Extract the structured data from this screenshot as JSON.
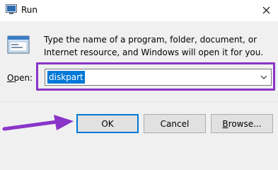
{
  "window": {
    "title": "Run",
    "close_glyph": "✕"
  },
  "dialog": {
    "description": "Type the name of a program, folder, document, or Internet resource, and Windows will open it for you.",
    "open_label_underlined": "O",
    "open_label_rest": "pen:",
    "open_value": "diskpart"
  },
  "buttons": {
    "ok": "OK",
    "cancel": "Cancel",
    "browse_underlined": "B",
    "browse_rest": "rowse..."
  },
  "colors": {
    "accent": "#0078d7",
    "annotation": "#8a35c9"
  },
  "icons": [
    "run-app-icon",
    "close-icon",
    "run-program-icon",
    "dropdown-chevron-icon",
    "annotation-arrow"
  ]
}
